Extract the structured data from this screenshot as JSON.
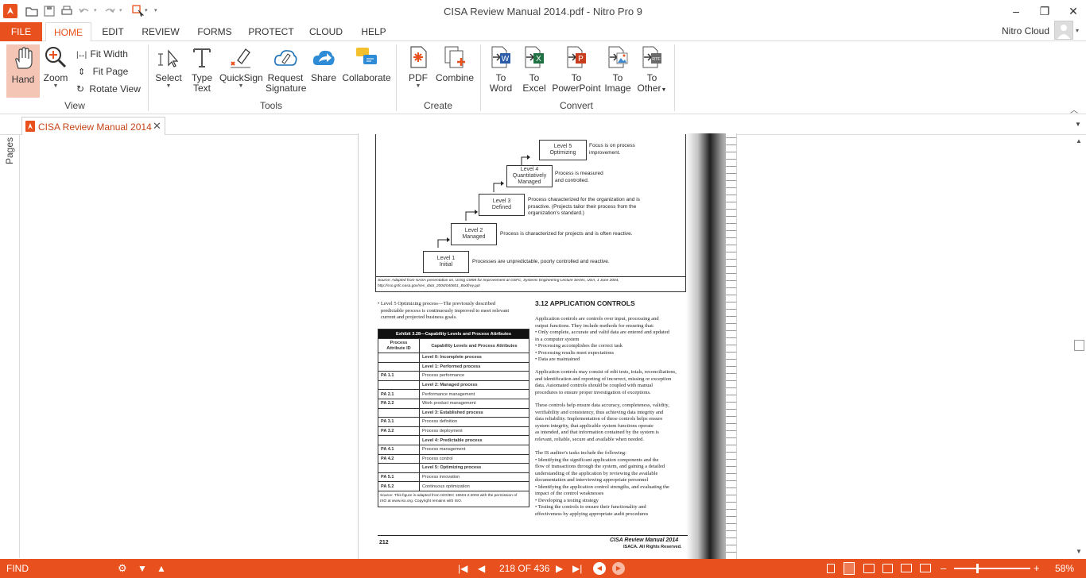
{
  "window": {
    "title": "CISA Review Manual 2014.pdf - Nitro Pro 9",
    "minimize": "–",
    "restore": "❐",
    "close": "✕"
  },
  "ribbon_tabs": [
    "FILE",
    "HOME",
    "EDIT",
    "REVIEW",
    "FORMS",
    "PROTECT",
    "CLOUD",
    "HELP"
  ],
  "account": {
    "label": "Nitro Cloud"
  },
  "ribbon": {
    "hand": "Hand",
    "zoom": "Zoom",
    "fit_width": "Fit Width",
    "fit_page": "Fit Page",
    "rotate_view": "Rotate View",
    "group_view": "View",
    "select": "Select",
    "type_text_1": "Type",
    "type_text_2": "Text",
    "quicksign": "QuickSign",
    "request_sig_1": "Request",
    "request_sig_2": "Signature",
    "share": "Share",
    "collaborate": "Collaborate",
    "group_tools": "Tools",
    "pdf": "PDF",
    "combine": "Combine",
    "group_create": "Create",
    "to_word_1": "To",
    "to_word_2": "Word",
    "to_excel_1": "To",
    "to_excel_2": "Excel",
    "to_ppt_1": "To",
    "to_ppt_2": "PowerPoint",
    "to_image_1": "To",
    "to_image_2": "Image",
    "to_other_1": "To",
    "to_other_2": "Other",
    "group_convert": "Convert"
  },
  "document_tab": {
    "label": "CISA Review Manual 2014"
  },
  "left_panel": {
    "pages_label": "Pages"
  },
  "page": {
    "levels": [
      {
        "l1": "Level 5",
        "l2": "Optimizing",
        "desc": [
          "Focus is on process",
          "improvement."
        ]
      },
      {
        "l1": "Level 4",
        "l2": "Quantitatively",
        "l3": "Managed",
        "desc": [
          "Process is measured",
          "and controlled."
        ]
      },
      {
        "l1": "Level 3",
        "l2": "Defined",
        "desc": [
          "Process characterized for the organization and is",
          "proactive. (Projects tailor their process from the",
          "organization's standard.)"
        ]
      },
      {
        "l1": "Level 2",
        "l2": "Managed",
        "desc": [
          "Process is characterized for projects and is often reactive."
        ]
      },
      {
        "l1": "Level 1",
        "l2": "Initial",
        "desc": [
          "Processes are unpredictable, poorly controlled and reactive."
        ]
      }
    ],
    "figure_source_1": "Source: Adapted from NASA presentation on, Using CMMI for Improvement at GSFC, Systems Engineering Lecture Series, USA, 1 June 2004,",
    "figure_source_2": "http://sso.gsfc.nasa.gov/ses_data_2004/040601_Bodfrey.ppt",
    "bullet_l5_1": "• Level 5 Optimizing process—The previously described",
    "bullet_l5_2": "predictable process is continuously improved to meet relevant",
    "bullet_l5_3": "current and projected business goals.",
    "exhibit_title": "Exhibit 3.28—Capability Levels and Process Attributes",
    "exhibit_h1a": "Process",
    "exhibit_h1b": "Attribute ID",
    "exhibit_h2": "Capability Levels and Process Attributes",
    "exhibit_rows": [
      {
        "id": "",
        "text": "Level 0:  Incomplete process",
        "bold": true
      },
      {
        "id": "",
        "text": "Level 1:  Performed process",
        "bold": true
      },
      {
        "id": "PA 1.1",
        "text": "Process performance",
        "bold": false
      },
      {
        "id": "",
        "text": "Level 2:  Managed process",
        "bold": true
      },
      {
        "id": "PA 2.1",
        "text": "Performance management",
        "bold": false
      },
      {
        "id": "PA 2.2",
        "text": "Work product management",
        "bold": false
      },
      {
        "id": "",
        "text": "Level 3:  Established process",
        "bold": true
      },
      {
        "id": "PA 3.1",
        "text": "Process definition",
        "bold": false
      },
      {
        "id": "PA 3.2",
        "text": "Process deployment",
        "bold": false
      },
      {
        "id": "",
        "text": "Level 4:  Predictable process",
        "bold": true
      },
      {
        "id": "PA 4.1",
        "text": "Process management",
        "bold": false
      },
      {
        "id": "PA 4.2",
        "text": "Process control",
        "bold": false
      },
      {
        "id": "",
        "text": "Level 5:  Optimizing process",
        "bold": true
      },
      {
        "id": "PA 5.1",
        "text": "Process innovation",
        "bold": false
      },
      {
        "id": "PA 5.2",
        "text": "Continuous optimization",
        "bold": false
      }
    ],
    "exhibit_source_1": "Source: This figure is adapted from ISO/IEC 15504-2:2003 with the permission of",
    "exhibit_source_2": "ISO at www.iso.org. Copyright remains with ISO.",
    "section_heading": "3.12  APPLICATION CONTROLS",
    "para1": [
      "Application controls are controls over input, processing and",
      "output functions. They include methods for ensuring that:",
      "• Only complete, accurate and valid data are entered and updated",
      "   in a computer system",
      "• Processing accomplishes the correct task",
      "• Processing results meet expectations",
      "• Data are maintained"
    ],
    "para2": [
      "Application controls may consist of edit tests, totals, reconciliations,",
      "and identification and reporting of incorrect, missing or exception",
      "data. Automated controls should be coupled with manual",
      "procedures to ensure proper investigation of exceptions."
    ],
    "para3": [
      "These controls help ensure data accuracy, completeness, validity,",
      "verifiability and consistency, thus achieving data integrity and",
      "data reliability. Implementation of these controls helps ensure",
      "system integrity, that applicable system functions operate",
      "as intended, and that information contained by the system is",
      "relevant, reliable, secure and available when needed."
    ],
    "para4": [
      "The IS auditor's tasks include the following:",
      "• Identifying the significant application components and the",
      "   flow of transactions through the system, and gaining a detailed",
      "   understanding of the application by reviewing the available",
      "   documentation and interviewing appropriate personnel",
      "• Identifying the application control strengths, and evaluating the",
      "   impact of the control weaknesses",
      "• Developing a testing strategy",
      "• Testing the controls to ensure their functionality and",
      "   effectiveness by applying appropriate audit procedures"
    ],
    "page_number": "212",
    "footer_title": "CISA Review Manual 2014",
    "footer_rights": "ISACA. All Rights Reserved."
  },
  "status": {
    "find": "FIND",
    "page_indicator": "218 OF 436",
    "zoom": "58%",
    "zoom_minus": "–",
    "zoom_plus": "+",
    "zoom_level_fraction": 0.58
  },
  "colors": {
    "accent": "#e8501d"
  }
}
